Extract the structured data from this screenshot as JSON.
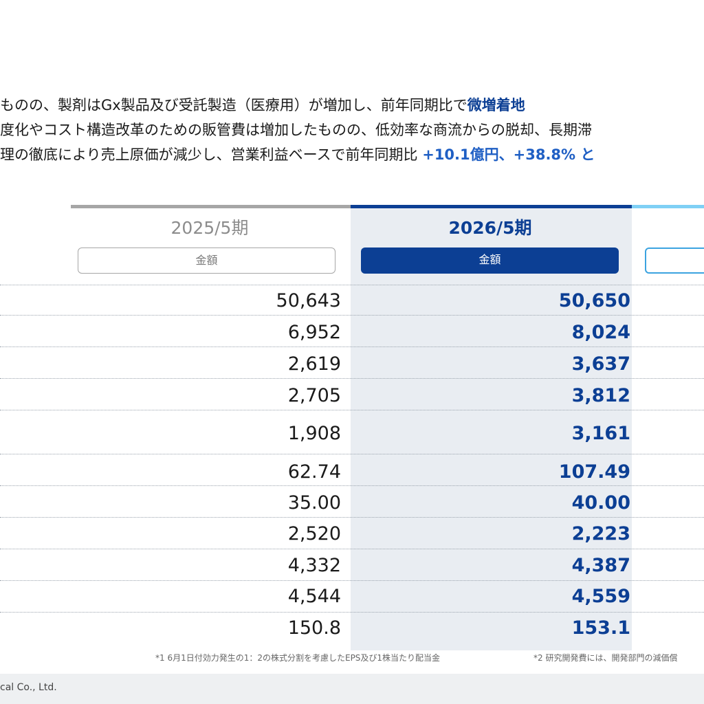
{
  "summary": {
    "line1_text": "ものの、製剤はGx製品及び受託製造（医療用）が増加し、前年同期比で",
    "line1_highlight": "微増着地",
    "line2_text": "度化やコスト構造改革のための販管費は増加したものの、低効率な商流からの脱却、長期滞",
    "line3_text": "理の徹底により売上原価が減少し、営業利益ベースで前年同期比",
    "line3_highlight": "+10.1億円、+38.8% と"
  },
  "table": {
    "prev_header": "2025/5期",
    "curr_header": "2026/5期",
    "prev_subheader": "金額",
    "curr_subheader": "金額",
    "prev_values": [
      "50,643",
      "6,952",
      "2,619",
      "2,705",
      "1,908",
      "62.74",
      "35.00",
      "2,520",
      "4,332",
      "4,544",
      "150.8"
    ],
    "curr_values": [
      "50,650",
      "8,024",
      "3,637",
      "3,812",
      "3,161",
      "107.49",
      "40.00",
      "2,223",
      "4,387",
      "4,559",
      "153.1"
    ]
  },
  "footnotes": {
    "note1": "*1 6月1日付効力発生の1：2の株式分割を考慮したEPS及び1株当たり配当金",
    "note2": "*2 研究開発費には、開発部門の減価償"
  },
  "footer": {
    "copyright": "cal Co., Ltd."
  },
  "colors": {
    "accent_dark": "#0c3f94",
    "accent_light": "#7fd0f5",
    "prev_bar": "#a6a6a6",
    "column_bg": "#e9edf2"
  }
}
